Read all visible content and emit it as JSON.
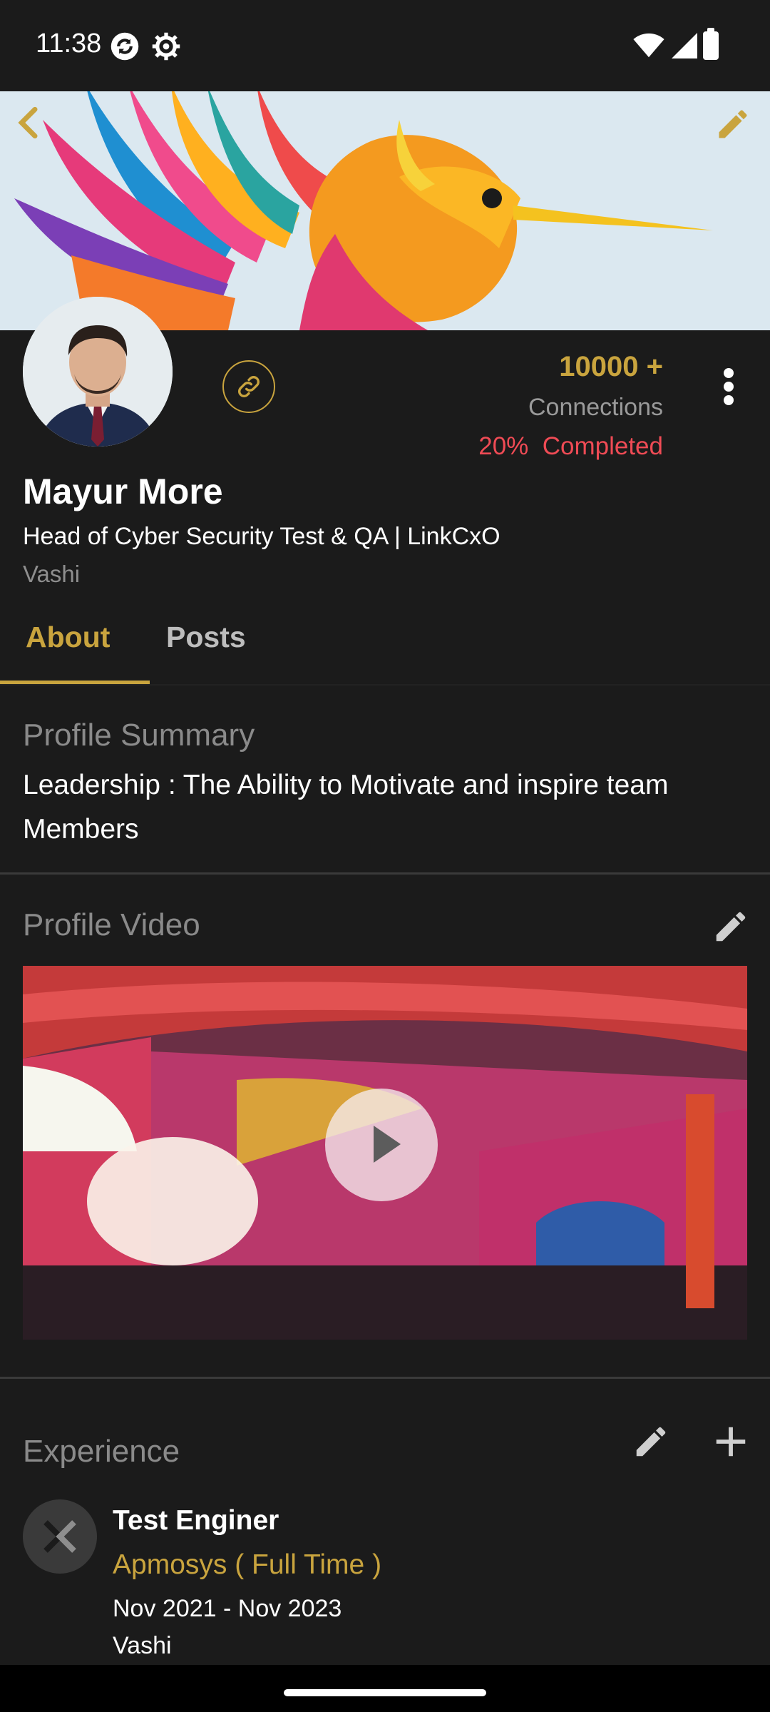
{
  "status_bar": {
    "time": "11:38",
    "icons": [
      "sync-icon",
      "gear-icon",
      "wifi-icon",
      "signal-icon",
      "battery-icon"
    ]
  },
  "header": {
    "icons": [
      "back-arrow-icon",
      "edit-pencil-icon"
    ]
  },
  "profile": {
    "connections_count": "10000 +",
    "connections_label": "Connections",
    "completion": "20%  Completed",
    "name": "Mayur More",
    "headline": "Head of Cyber Security Test & QA | LinkCxO",
    "location": "Vashi"
  },
  "tabs": [
    {
      "label": "About",
      "selected": true
    },
    {
      "label": "Posts",
      "selected": false
    }
  ],
  "summary": {
    "title": "Profile Summary",
    "text": "Leadership : The Ability to Motivate and inspire team Members"
  },
  "video": {
    "title": "Profile Video"
  },
  "experience": {
    "title": "Experience",
    "items": [
      {
        "job_title": "Test Enginer",
        "company": "Apmosys ( Full Time )",
        "dates": "Nov 2021 - Nov 2023",
        "location": "Vashi"
      }
    ]
  },
  "colors": {
    "background": "#1b1b1b",
    "accent_gold": "#c9a43e",
    "completion_red": "#ef4b55",
    "muted_text": "#8a8a8a"
  }
}
